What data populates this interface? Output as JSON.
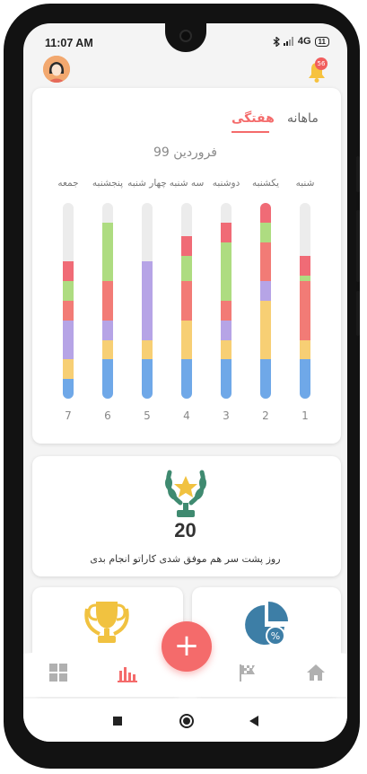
{
  "status": {
    "time": "11:07 AM",
    "network": "4G",
    "battery": "11"
  },
  "header": {
    "notification_count": "56"
  },
  "tabs": [
    {
      "label": "ماهانه"
    },
    {
      "label": "هفتگی"
    }
  ],
  "chart_card": {
    "month_label": "فروردین 99"
  },
  "chart_data": {
    "type": "stacked-bar",
    "categories": [
      "شنبه",
      "یکشنبه",
      "دوشنبه",
      "سه شنبه",
      "چهار شنبه",
      "پنجشنبه",
      "جمعه"
    ],
    "numbers": [
      "1",
      "2",
      "3",
      "4",
      "5",
      "6",
      "7"
    ],
    "segment_colors": [
      "#6fa8e8",
      "#f7cf74",
      "#b6a4e6",
      "#f27b76",
      "#aedc81",
      "#f06b76"
    ],
    "series": [
      {
        "values": [
          0.2,
          0.1,
          0.0,
          0.3,
          0.03,
          0.1
        ]
      },
      {
        "values": [
          0.2,
          0.3,
          0.1,
          0.2,
          0.1,
          0.1
        ]
      },
      {
        "values": [
          0.2,
          0.1,
          0.1,
          0.1,
          0.3,
          0.1
        ]
      },
      {
        "values": [
          0.2,
          0.2,
          0.0,
          0.2,
          0.13,
          0.1
        ]
      },
      {
        "values": [
          0.2,
          0.1,
          0.4,
          0.0,
          0.0,
          0.0
        ]
      },
      {
        "values": [
          0.2,
          0.1,
          0.1,
          0.2,
          0.3,
          0.0
        ]
      },
      {
        "values": [
          0.1,
          0.1,
          0.2,
          0.1,
          0.1,
          0.1
        ]
      }
    ]
  },
  "streak_card": {
    "value": "20",
    "text": "روز پشت سر هم موفق شدی کاراتو انجام بدی"
  },
  "colors": {
    "accent": "#f46b6b",
    "trophy": "#f1c240",
    "laurel": "#3f8a70",
    "pie": "#3d7ea6",
    "nav_icon": "#b0b0b0"
  },
  "nav": {
    "items": [
      {
        "icon": "grid-icon"
      },
      {
        "icon": "bar-chart-icon"
      },
      {
        "icon": "flag-icon"
      },
      {
        "icon": "home-icon"
      }
    ],
    "fab_icon": "plus-icon"
  }
}
